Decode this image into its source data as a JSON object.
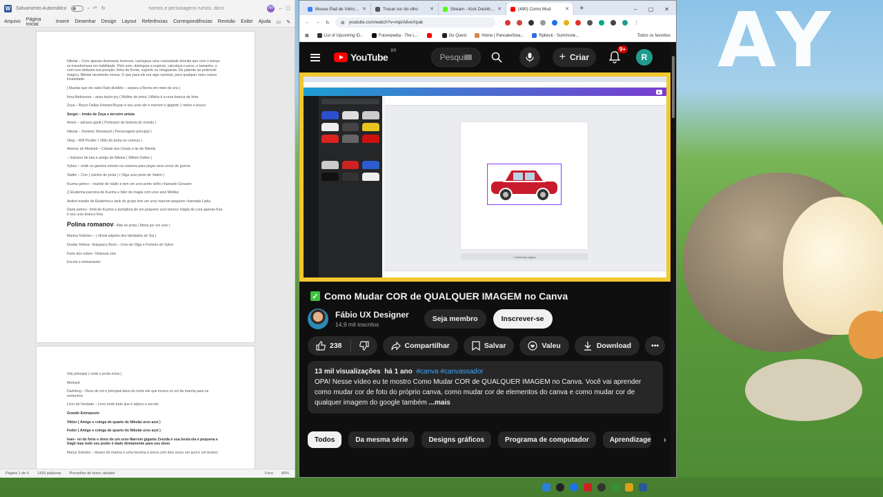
{
  "wallpaper": {
    "text": "AY"
  },
  "word": {
    "autosave_label": "Salvamento Automático",
    "doc_title": "nomes e personagens rumos. docx",
    "avatar": "RP",
    "menu": [
      "Arquivo",
      "Página Inicial",
      "Inserir",
      "Desenhar",
      "Design",
      "Layout",
      "Referências",
      "Correspondências",
      "Revisão",
      "Exibir",
      "Ajuda"
    ],
    "page1": [
      {
        "text": "Nikolai – Com apenas dezesseis invernos, carregava uma curiosidade doentia que com o tempo se transformara em habilidade. Pelo som, distinguia a espécie, calculava o peso, o tamanho, e com isso deduzia sua posição: linha de frente, suporte ou retaguarda. Da patente ao potencial mágico, Nikolai raramente errava. O que para ele era algo racional, para qualquer outro soava insanidade.",
        "style": ""
      },
      {
        "text": "( Mazlas que ele sabe Raio dividido – separa a flecha em meio de uns )",
        "style": ""
      },
      {
        "text": "Irina Alekseeva – anya taylor-joy ( Mulher do prota ) Misha é a ursa branca de Irina",
        "style": ""
      },
      {
        "text": "Zoya – Bryce Dallas Howard Buyan é seu urso ele é marrom e gigante 1 metro e pouco",
        "style": ""
      },
      {
        "text": "Sergei – irmão de Zoya e terceiro anista",
        "style": "b"
      },
      {
        "text": "Anton – adriano garib ( Professor de historia do mundo )",
        "style": ""
      },
      {
        "text": "Nikolai – Dominic Sherwood ( Personagem principal )",
        "style": ""
      },
      {
        "text": "Oleg – Will Poulter ( Vilão do prota no começo )",
        "style": ""
      },
      {
        "text": "Abismo de Medved – Cidade dos Ursais e lar de Nikolai",
        "style": ""
      },
      {
        "text": "– Instrutor de luta e amigo de Nikolai ( Willem Dafoe )",
        "style": ""
      },
      {
        "text": "Vyboz – onde os garotos entram na caverna para pegar seus ursos de guerra",
        "style": ""
      },
      {
        "text": "Vadim – Crer ( vizinho do prota ) ( Olga urso preto de Vadim )",
        "style": ""
      },
      {
        "text": "Kuzma petrov – marido de Vadin e tem um urso preto velho chamado Gerasim",
        "style": ""
      },
      {
        "text": "(( Ekaterina parceira de Kuzma e líder de magia com urso azul Mishka",
        "style": ""
      },
      {
        "text": "Andrei marido de Ekaterina e tank do grupo tem um urso marrom pequeno chamado Laika",
        "style": ""
      },
      {
        "text": "Daria petrov– Irmã de Kuzma e portadora de um pequeno urso branco mágia de cura apenas Kira é seu urso branco Kira",
        "style": ""
      }
    ],
    "page1_heading": "Polina romanov",
    "page1_heading_suffix": "– Mãe do prota ( Morta por um urso )",
    "page1_tail": [
      {
        "text": "Marina Sobolev – ( oficial adjunto dos blindados do Sul )",
        "style": ""
      },
      {
        "text": "Druida Yelena– Katyparry Boris – Urso de Olga e Porteiro do Vybor",
        "style": ""
      },
      {
        "text": "Forte dos nobre– Nobreza vive",
        "style": ""
      },
      {
        "text": "Escola e treinamento",
        "style": ""
      }
    ],
    "page2": [
      {
        "text": "Vila principal ( onde o prota mora )",
        "style": ""
      },
      {
        "text": "Medved",
        "style": ""
      },
      {
        "text": "Dazhbog – Deus do sol e principal deus do norte ele que invoca os sol da manha para os nortenhos",
        "style": ""
      },
      {
        "text": "Livro da Verdade – Livro onde tudo que é atípico e escrito",
        "style": ""
      },
      {
        "text": "Grande Entreposto",
        "style": "b"
      },
      {
        "text": "Viktor ( Amigo e colega de quarto de Nikolai urso azul )",
        "style": "b"
      },
      {
        "text": "Fedor ( Amigo e colega de quarto do Nikolai urso azul )",
        "style": "b"
      },
      {
        "text": "Ivan– rei do forte e dono de um urso Marrom gigante Zvezda é sua besta ela é pequena e frágil mas todo seu poder é dado diretamente para seu dono",
        "style": "b"
      },
      {
        "text": "Marya Sobolev – bisavo de marina e uma heroína a única com dois ursos um azul e um branco",
        "style": ""
      }
    ],
    "status": {
      "page": "Página 1 de 6",
      "words": "1416 palavras",
      "predictions": "Previsões de texto: ativado",
      "focus": "Foco",
      "zoom": "80%"
    }
  },
  "browser": {
    "tabs": [
      {
        "label": "Mouse Pad de Vidro GLA",
        "color": "#3b82f6",
        "active": false
      },
      {
        "label": "Trocar cor do olho",
        "color": "#555555",
        "active": false
      },
      {
        "label": "Stream - Kick Dashboard",
        "color": "#53fc18",
        "active": false
      },
      {
        "label": "(490) Como Mud",
        "color": "#ff0000",
        "active": true
      }
    ],
    "url": "youtube.com/watch?v=Aqi/A8veXpak",
    "bookmarks": [
      {
        "label": "List of Upcoming ID...",
        "color": "#333333"
      },
      {
        "label": "Futurepedia - The L...",
        "color": "#111111"
      },
      {
        "label": "",
        "color": "#ff0000"
      },
      {
        "label": "Go Quest",
        "color": "#222222"
      },
      {
        "label": "Home | PancakeSwa...",
        "color": "#d1884f"
      },
      {
        "label": "Rpbeck - Summone...",
        "color": "#2d6cdf"
      }
    ],
    "bookmarks_other": "Todos os favoritos"
  },
  "youtube": {
    "logo": "YouTube",
    "region": "BR",
    "search_placeholder": "Pesqui",
    "create_label": "Criar",
    "notif_badge": "9+",
    "avatar_letter": "R",
    "video_title": "Como Mudar COR de QUALQUER IMAGEM no Canva",
    "channel_name": "Fábio UX Designer",
    "channel_subs": "14,9 mil inscritos",
    "join_label": "Seja membro",
    "subscribe_label": "Inscrever-se",
    "likes": "238",
    "share_label": "Compartilhar",
    "save_label": "Salvar",
    "thanks_label": "Valeu",
    "download_label": "Download",
    "desc_views": "13 mil visualizações",
    "desc_age": "há 1 ano",
    "desc_tags": "#canva #canvassador",
    "desc_text": "OPA! Nesse vídeo eu te mostro Como Mudar COR de QUALQUER IMAGEM no Canva. Você vai aprender como mudar cor de foto do próprio canva, como mudar cor de elementos do canva e como mudar cor de qualquer imagem do google também",
    "desc_more": " ...mais",
    "chips": [
      "Todos",
      "Da mesma série",
      "Designs gráficos",
      "Programa de computador",
      "Aprendizagem"
    ],
    "canva": {
      "add_page": "+ Adicionar página"
    }
  },
  "colors": {
    "yt_bg": "#0f0f0f",
    "yt_red": "#ff0000",
    "video_border": "#f2c830",
    "link_blue": "#3ea6ff"
  }
}
